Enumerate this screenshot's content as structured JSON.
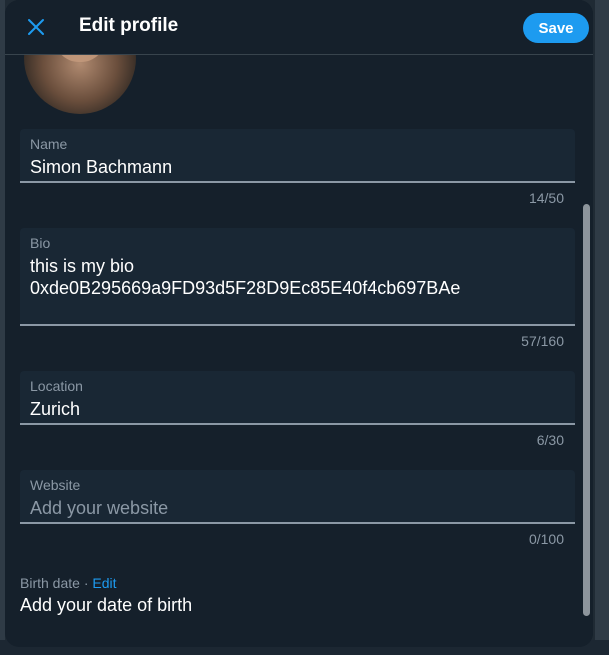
{
  "header": {
    "title": "Edit profile",
    "save_label": "Save"
  },
  "fields": {
    "name": {
      "label": "Name",
      "value": "Simon Bachmann",
      "counter": "14/50"
    },
    "bio": {
      "label": "Bio",
      "value": "this is my bio\n0xde0B295669a9FD93d5F28D9Ec85E40f4cb697BAe",
      "counter": "57/160"
    },
    "location": {
      "label": "Location",
      "value": "Zurich",
      "counter": "6/30"
    },
    "website": {
      "label": "Website",
      "placeholder": "Add your website",
      "value": "",
      "counter": "0/100"
    }
  },
  "birth_date": {
    "label": "Birth date · ",
    "edit_label": "Edit",
    "value": "Add your date of birth"
  },
  "colors": {
    "accent": "#1d9bf0",
    "background": "#15202b",
    "field_background": "#192734",
    "muted_text": "#8b98a5"
  },
  "icons": {
    "close": "close-icon",
    "camera": "camera-icon"
  }
}
